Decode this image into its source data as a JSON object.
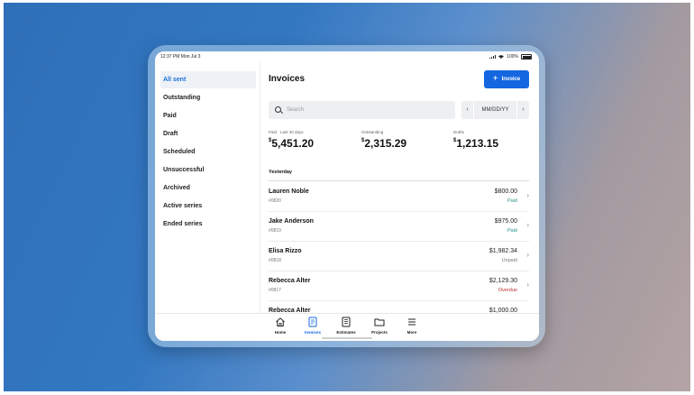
{
  "status_bar": {
    "time": "12:37 PM  Mon Jul 3",
    "battery": "100%"
  },
  "sidebar": {
    "items": [
      {
        "label": "All sent",
        "selected": true
      },
      {
        "label": "Outstanding",
        "selected": false
      },
      {
        "label": "Paid",
        "selected": false
      },
      {
        "label": "Draft",
        "selected": false
      },
      {
        "label": "Scheduled",
        "selected": false
      },
      {
        "label": "Unsuccessful",
        "selected": false
      },
      {
        "label": "Archived",
        "selected": false
      },
      {
        "label": "Active series",
        "selected": false
      },
      {
        "label": "Ended series",
        "selected": false
      }
    ]
  },
  "header": {
    "title": "Invoices",
    "new_button_label": "Invoice"
  },
  "search": {
    "placeholder": "Search"
  },
  "date_picker": {
    "value": "MM/DD/YY",
    "prev_icon": "chevron-left-icon",
    "next_icon": "chevron-right-icon"
  },
  "stats": [
    {
      "label": "Paid · Last 30 days",
      "currency": "$",
      "amount": "5,451.20"
    },
    {
      "label": "Outstanding",
      "currency": "$",
      "amount": "2,315.29"
    },
    {
      "label": "Drafts",
      "currency": "$",
      "amount": "1,213.15"
    }
  ],
  "list": {
    "section_label": "Yesterday",
    "rows": [
      {
        "name": "Lauren Noble",
        "number": "#0820",
        "amount": "$800.00",
        "status": "Paid",
        "status_kind": "paid"
      },
      {
        "name": "Jake Anderson",
        "number": "#0819",
        "amount": "$975.00",
        "status": "Paid",
        "status_kind": "paid"
      },
      {
        "name": "Elisa Rizzo",
        "number": "#0818",
        "amount": "$1,982.34",
        "status": "Unpaid",
        "status_kind": "unpaid"
      },
      {
        "name": "Rebecca Alter",
        "number": "#0817",
        "amount": "$2,129.30",
        "status": "Overdue",
        "status_kind": "overdue"
      },
      {
        "name": "Rebecca Alter",
        "number": "",
        "amount": "$1,000.00",
        "status": "",
        "status_kind": ""
      }
    ]
  },
  "tabbar": {
    "items": [
      {
        "label": "Home",
        "icon": "home-icon",
        "selected": false
      },
      {
        "label": "Invoices",
        "icon": "invoice-icon",
        "selected": true
      },
      {
        "label": "Estimates",
        "icon": "estimate-icon",
        "selected": false
      },
      {
        "label": "Projects",
        "icon": "folder-icon",
        "selected": false
      },
      {
        "label": "More",
        "icon": "menu-icon",
        "selected": false
      }
    ]
  },
  "colors": {
    "accent": "#1467e0",
    "paid": "#2a8f8a",
    "overdue": "#c03030",
    "selected_bg": "#eef2f7"
  }
}
